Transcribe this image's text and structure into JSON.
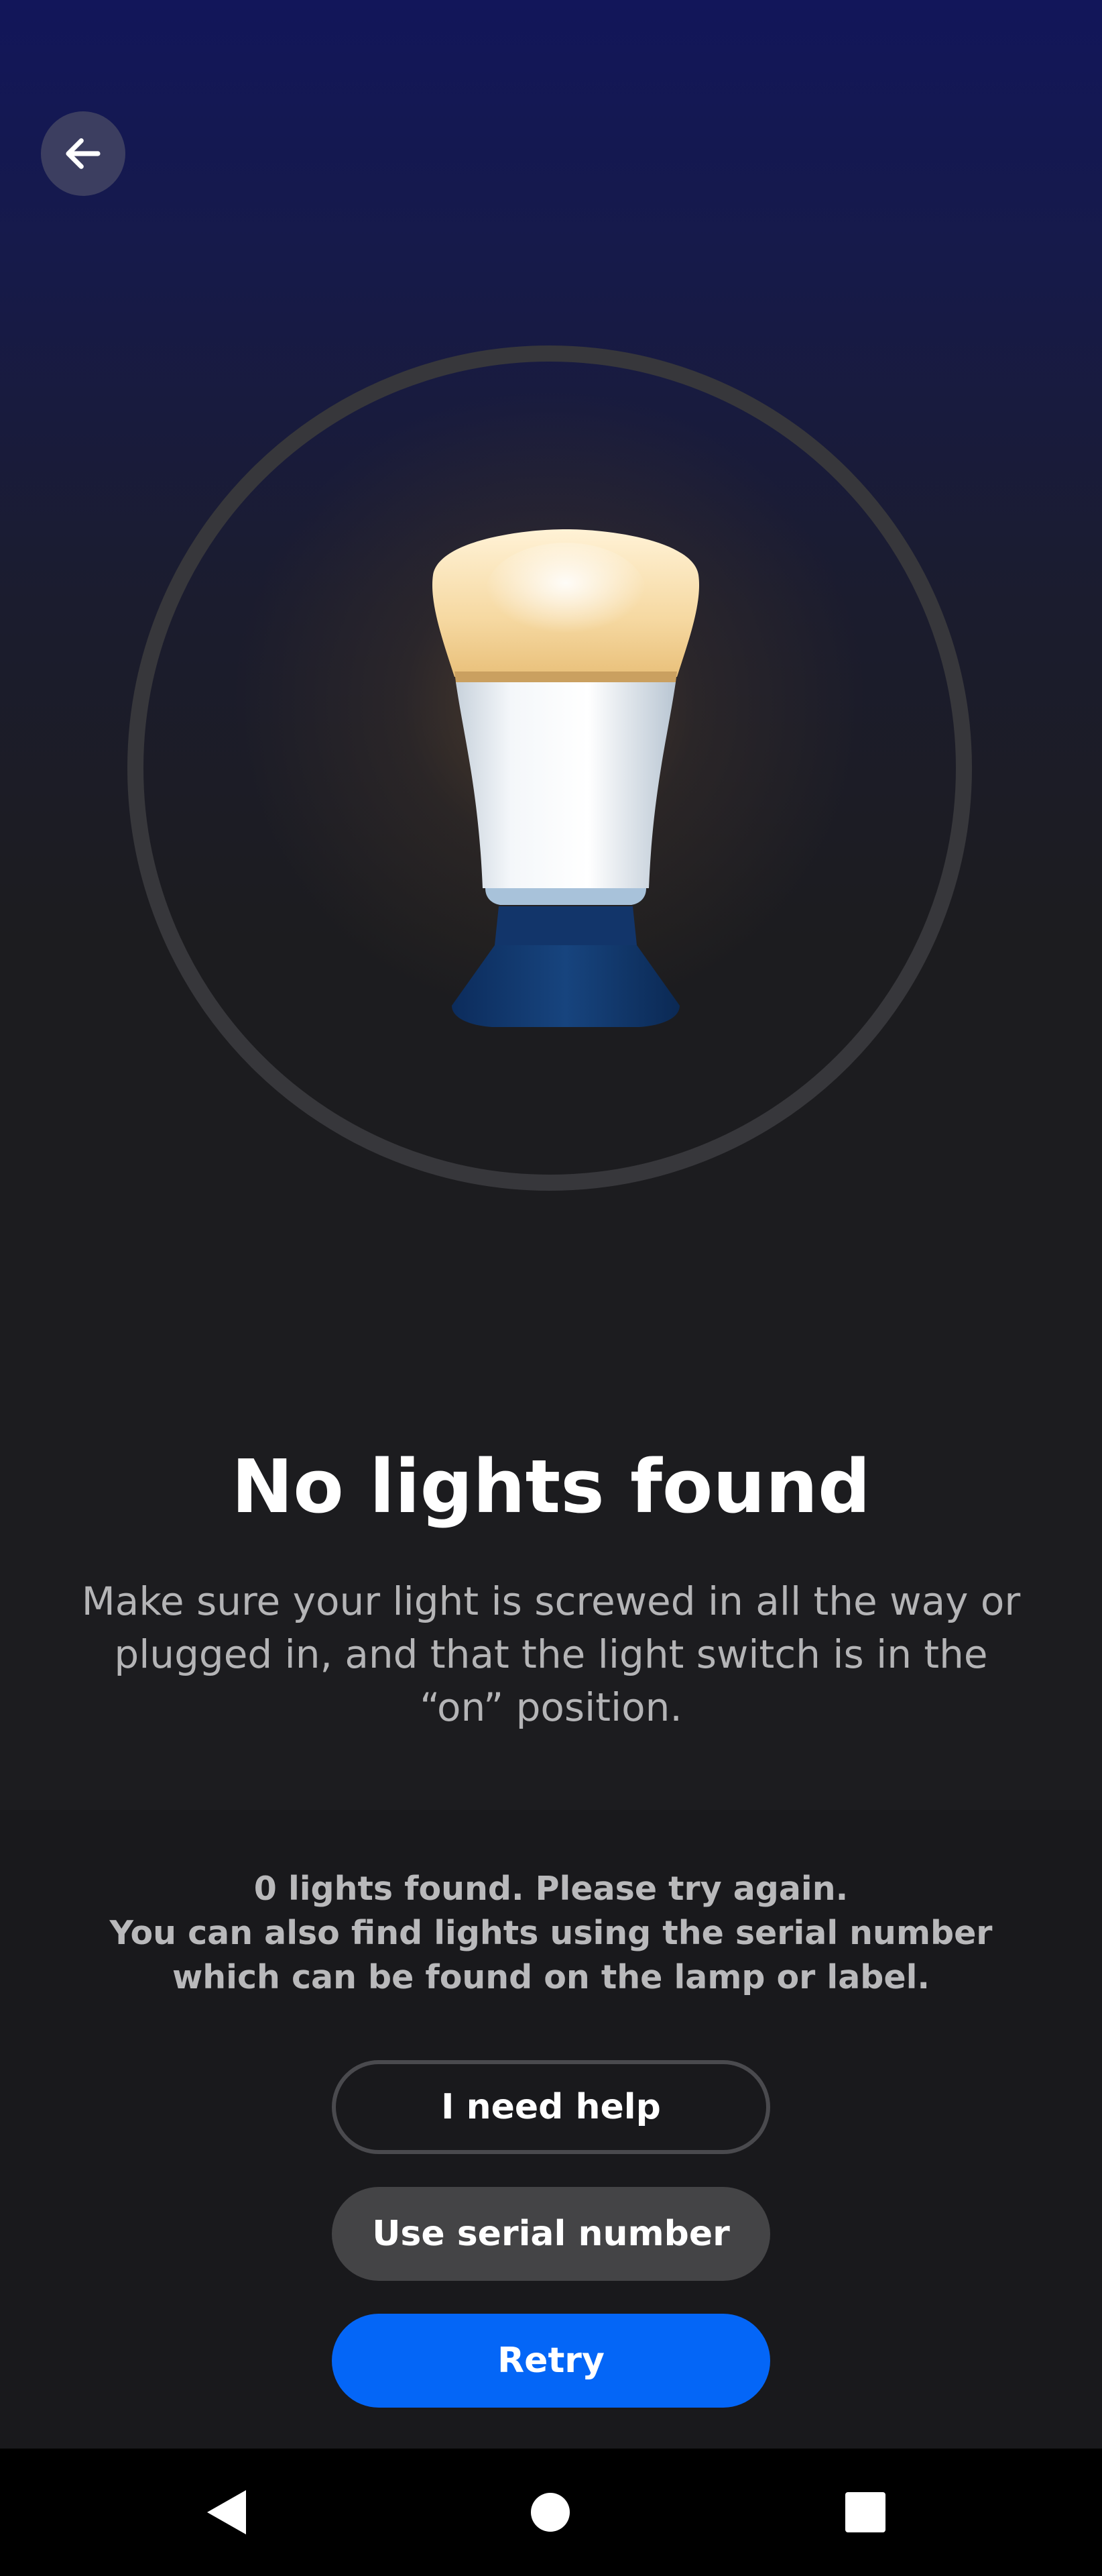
{
  "header": {
    "back_icon": "arrow-left-icon"
  },
  "hero": {
    "image": "light-bulb-illustration"
  },
  "main": {
    "title": "No lights found",
    "description": "Make sure your light is screwed in all the way or plugged in, and that the light switch is in the “on” position."
  },
  "footer": {
    "status_line_1": "0 lights found. Please try again.",
    "status_line_2": "You can also find lights using the serial number which can be found on the lamp or label.",
    "help_label": "I need help",
    "serial_label": "Use serial number",
    "retry_label": "Retry"
  },
  "system_nav": {
    "back_icon": "triangle-back-icon",
    "home_icon": "circle-home-icon",
    "recents_icon": "square-recents-icon"
  },
  "colors": {
    "accent": "#0466f7",
    "background": "#1c1c1f",
    "header_gradient": "#12165a"
  }
}
